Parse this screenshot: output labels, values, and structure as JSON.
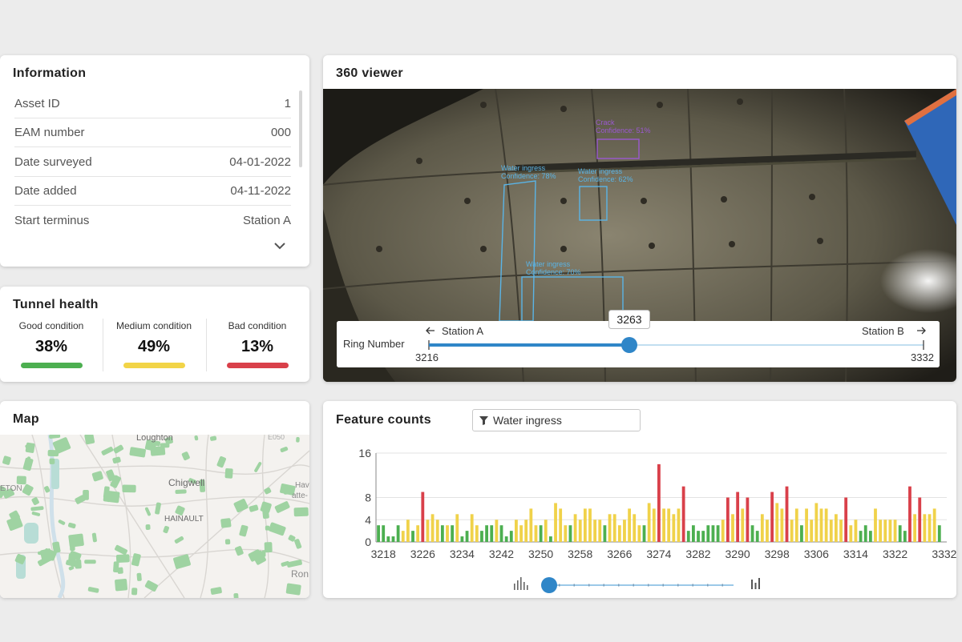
{
  "info": {
    "title": "Information",
    "rows": [
      {
        "label": "Asset ID",
        "value": "1"
      },
      {
        "label": "EAM number",
        "value": "000"
      },
      {
        "label": "Date surveyed",
        "value": "04-01-2022"
      },
      {
        "label": "Date added",
        "value": "04-11-2022"
      },
      {
        "label": "Start terminus",
        "value": "Station A"
      }
    ]
  },
  "health": {
    "title": "Tunnel health",
    "items": [
      {
        "label": "Good condition",
        "value": "38%",
        "color": "#4caf50"
      },
      {
        "label": "Medium condition",
        "value": "49%",
        "color": "#f2d447"
      },
      {
        "label": "Bad condition",
        "value": "13%",
        "color": "#d9404a"
      }
    ]
  },
  "map": {
    "title": "Map",
    "places": [
      "Loughton",
      "Chigwell",
      "HAINAULT",
      "ETON",
      "Hav",
      "atte-",
      "Ron",
      "E050"
    ]
  },
  "viewer": {
    "title": "360 viewer",
    "detections": [
      {
        "label": "Crack",
        "confidence": "Confidence: 51%",
        "color": "#9b59d0"
      },
      {
        "label": "Water ingress",
        "confidence": "Confidence: 78%",
        "color": "#5ab4e6"
      },
      {
        "label": "Water ingress",
        "confidence": "Confidence: 62%",
        "color": "#5ab4e6"
      },
      {
        "label": "Water ingress",
        "confidence": "Confidence: 70%",
        "color": "#5ab4e6"
      }
    ],
    "ring": {
      "label": "Ring Number",
      "start_station": "Station A",
      "end_station": "Station B",
      "min": 3216,
      "max": 3332,
      "current": 3263,
      "min_label": "3216",
      "max_label": "3332",
      "current_label": "3263"
    }
  },
  "features": {
    "title": "Feature counts",
    "filter_value": "Water ingress",
    "slider_fraction": 0.0
  },
  "chart_data": {
    "type": "bar",
    "x_start": 3217,
    "x_end": 3332,
    "ylim": [
      0,
      16
    ],
    "yticks": [
      0,
      4,
      8,
      16
    ],
    "xticks": [
      3218,
      3226,
      3234,
      3242,
      3250,
      3258,
      3266,
      3274,
      3282,
      3290,
      3298,
      3306,
      3314,
      3322,
      3332
    ],
    "colors": {
      "good": "#4caf50",
      "medium": "#f0d24a",
      "bad": "#d9404a"
    },
    "bars": [
      {
        "x": 3217,
        "v": 3,
        "c": "good"
      },
      {
        "x": 3218,
        "v": 3,
        "c": "good"
      },
      {
        "x": 3219,
        "v": 1,
        "c": "good"
      },
      {
        "x": 3220,
        "v": 1,
        "c": "good"
      },
      {
        "x": 3221,
        "v": 3,
        "c": "good"
      },
      {
        "x": 3222,
        "v": 2,
        "c": "medium"
      },
      {
        "x": 3223,
        "v": 4,
        "c": "medium"
      },
      {
        "x": 3224,
        "v": 2,
        "c": "good"
      },
      {
        "x": 3225,
        "v": 3,
        "c": "medium"
      },
      {
        "x": 3226,
        "v": 9,
        "c": "bad"
      },
      {
        "x": 3227,
        "v": 4,
        "c": "medium"
      },
      {
        "x": 3228,
        "v": 5,
        "c": "medium"
      },
      {
        "x": 3229,
        "v": 4,
        "c": "medium"
      },
      {
        "x": 3230,
        "v": 3,
        "c": "good"
      },
      {
        "x": 3231,
        "v": 3,
        "c": "medium"
      },
      {
        "x": 3232,
        "v": 3,
        "c": "good"
      },
      {
        "x": 3233,
        "v": 5,
        "c": "medium"
      },
      {
        "x": 3234,
        "v": 1,
        "c": "good"
      },
      {
        "x": 3235,
        "v": 2,
        "c": "good"
      },
      {
        "x": 3236,
        "v": 5,
        "c": "medium"
      },
      {
        "x": 3237,
        "v": 3,
        "c": "medium"
      },
      {
        "x": 3238,
        "v": 2,
        "c": "good"
      },
      {
        "x": 3239,
        "v": 3,
        "c": "good"
      },
      {
        "x": 3240,
        "v": 3,
        "c": "good"
      },
      {
        "x": 3241,
        "v": 4,
        "c": "medium"
      },
      {
        "x": 3242,
        "v": 3,
        "c": "good"
      },
      {
        "x": 3243,
        "v": 1,
        "c": "good"
      },
      {
        "x": 3244,
        "v": 2,
        "c": "good"
      },
      {
        "x": 3245,
        "v": 4,
        "c": "medium"
      },
      {
        "x": 3246,
        "v": 3,
        "c": "medium"
      },
      {
        "x": 3247,
        "v": 4,
        "c": "medium"
      },
      {
        "x": 3248,
        "v": 6,
        "c": "medium"
      },
      {
        "x": 3249,
        "v": 3,
        "c": "medium"
      },
      {
        "x": 3250,
        "v": 3,
        "c": "good"
      },
      {
        "x": 3251,
        "v": 4,
        "c": "medium"
      },
      {
        "x": 3252,
        "v": 1,
        "c": "good"
      },
      {
        "x": 3253,
        "v": 7,
        "c": "medium"
      },
      {
        "x": 3254,
        "v": 6,
        "c": "medium"
      },
      {
        "x": 3255,
        "v": 3,
        "c": "medium"
      },
      {
        "x": 3256,
        "v": 3,
        "c": "good"
      },
      {
        "x": 3257,
        "v": 5,
        "c": "medium"
      },
      {
        "x": 3258,
        "v": 4,
        "c": "medium"
      },
      {
        "x": 3259,
        "v": 6,
        "c": "medium"
      },
      {
        "x": 3260,
        "v": 6,
        "c": "medium"
      },
      {
        "x": 3261,
        "v": 4,
        "c": "medium"
      },
      {
        "x": 3262,
        "v": 4,
        "c": "medium"
      },
      {
        "x": 3263,
        "v": 3,
        "c": "good"
      },
      {
        "x": 3264,
        "v": 5,
        "c": "medium"
      },
      {
        "x": 3265,
        "v": 5,
        "c": "medium"
      },
      {
        "x": 3266,
        "v": 3,
        "c": "medium"
      },
      {
        "x": 3267,
        "v": 4,
        "c": "medium"
      },
      {
        "x": 3268,
        "v": 6,
        "c": "medium"
      },
      {
        "x": 3269,
        "v": 5,
        "c": "medium"
      },
      {
        "x": 3270,
        "v": 3,
        "c": "medium"
      },
      {
        "x": 3271,
        "v": 3,
        "c": "good"
      },
      {
        "x": 3272,
        "v": 7,
        "c": "medium"
      },
      {
        "x": 3273,
        "v": 6,
        "c": "medium"
      },
      {
        "x": 3274,
        "v": 14,
        "c": "bad"
      },
      {
        "x": 3275,
        "v": 6,
        "c": "medium"
      },
      {
        "x": 3276,
        "v": 6,
        "c": "medium"
      },
      {
        "x": 3277,
        "v": 5,
        "c": "medium"
      },
      {
        "x": 3278,
        "v": 6,
        "c": "medium"
      },
      {
        "x": 3279,
        "v": 10,
        "c": "bad"
      },
      {
        "x": 3280,
        "v": 2,
        "c": "good"
      },
      {
        "x": 3281,
        "v": 3,
        "c": "good"
      },
      {
        "x": 3282,
        "v": 2,
        "c": "good"
      },
      {
        "x": 3283,
        "v": 2,
        "c": "good"
      },
      {
        "x": 3284,
        "v": 3,
        "c": "good"
      },
      {
        "x": 3285,
        "v": 3,
        "c": "good"
      },
      {
        "x": 3286,
        "v": 3,
        "c": "good"
      },
      {
        "x": 3287,
        "v": 4,
        "c": "medium"
      },
      {
        "x": 3288,
        "v": 8,
        "c": "bad"
      },
      {
        "x": 3289,
        "v": 5,
        "c": "medium"
      },
      {
        "x": 3290,
        "v": 9,
        "c": "bad"
      },
      {
        "x": 3291,
        "v": 6,
        "c": "medium"
      },
      {
        "x": 3292,
        "v": 8,
        "c": "bad"
      },
      {
        "x": 3293,
        "v": 3,
        "c": "good"
      },
      {
        "x": 3294,
        "v": 2,
        "c": "good"
      },
      {
        "x": 3295,
        "v": 5,
        "c": "medium"
      },
      {
        "x": 3296,
        "v": 4,
        "c": "medium"
      },
      {
        "x": 3297,
        "v": 9,
        "c": "bad"
      },
      {
        "x": 3298,
        "v": 7,
        "c": "medium"
      },
      {
        "x": 3299,
        "v": 6,
        "c": "medium"
      },
      {
        "x": 3300,
        "v": 10,
        "c": "bad"
      },
      {
        "x": 3301,
        "v": 4,
        "c": "medium"
      },
      {
        "x": 3302,
        "v": 6,
        "c": "medium"
      },
      {
        "x": 3303,
        "v": 3,
        "c": "good"
      },
      {
        "x": 3304,
        "v": 6,
        "c": "medium"
      },
      {
        "x": 3305,
        "v": 4,
        "c": "medium"
      },
      {
        "x": 3306,
        "v": 7,
        "c": "medium"
      },
      {
        "x": 3307,
        "v": 6,
        "c": "medium"
      },
      {
        "x": 3308,
        "v": 6,
        "c": "medium"
      },
      {
        "x": 3309,
        "v": 4,
        "c": "medium"
      },
      {
        "x": 3310,
        "v": 5,
        "c": "medium"
      },
      {
        "x": 3311,
        "v": 4,
        "c": "medium"
      },
      {
        "x": 3312,
        "v": 8,
        "c": "bad"
      },
      {
        "x": 3313,
        "v": 3,
        "c": "medium"
      },
      {
        "x": 3314,
        "v": 4,
        "c": "medium"
      },
      {
        "x": 3315,
        "v": 2,
        "c": "good"
      },
      {
        "x": 3316,
        "v": 3,
        "c": "good"
      },
      {
        "x": 3317,
        "v": 2,
        "c": "good"
      },
      {
        "x": 3318,
        "v": 6,
        "c": "medium"
      },
      {
        "x": 3319,
        "v": 4,
        "c": "medium"
      },
      {
        "x": 3320,
        "v": 4,
        "c": "medium"
      },
      {
        "x": 3321,
        "v": 4,
        "c": "medium"
      },
      {
        "x": 3322,
        "v": 4,
        "c": "medium"
      },
      {
        "x": 3323,
        "v": 3,
        "c": "good"
      },
      {
        "x": 3324,
        "v": 2,
        "c": "good"
      },
      {
        "x": 3325,
        "v": 10,
        "c": "bad"
      },
      {
        "x": 3326,
        "v": 5,
        "c": "medium"
      },
      {
        "x": 3327,
        "v": 8,
        "c": "bad"
      },
      {
        "x": 3328,
        "v": 5,
        "c": "medium"
      },
      {
        "x": 3329,
        "v": 5,
        "c": "medium"
      },
      {
        "x": 3330,
        "v": 6,
        "c": "medium"
      },
      {
        "x": 3331,
        "v": 3,
        "c": "good"
      }
    ]
  }
}
